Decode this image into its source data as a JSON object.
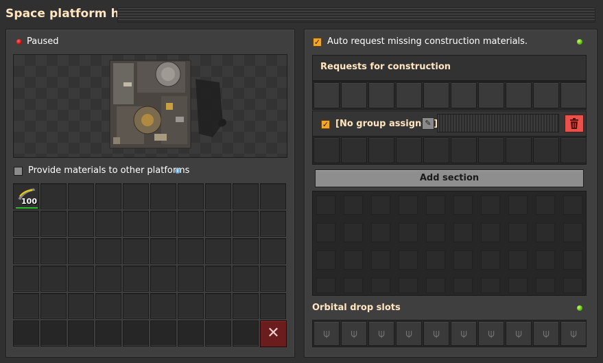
{
  "window": {
    "title": "Space platform hub"
  },
  "left": {
    "status": {
      "text": "Paused",
      "color": "#d00000"
    },
    "provide_checkbox": {
      "label": "Provide materials to other platforms",
      "checked": false
    },
    "inventory": {
      "first_slot": {
        "icon": "thruster-fuel-icon",
        "count": "100"
      },
      "trash_icon": "close-x-icon"
    }
  },
  "right": {
    "auto_request": {
      "label": "Auto request missing construction materials.",
      "checked": true,
      "indicator_color": "#4fb000"
    },
    "requests": {
      "title": "Requests for construction"
    },
    "group": {
      "label": "[No group assigned]",
      "checked": true,
      "edit_icon": "pencil-icon",
      "delete_icon": "trash-icon"
    },
    "add_section_label": "Add section",
    "orbital": {
      "title": "Orbital drop slots",
      "indicator_color": "#4fb000",
      "slot_icon": "cargo-pod-icon"
    }
  },
  "colors": {
    "title": "#ffe6c0",
    "panel": "#403f40",
    "accent_orange": "#f3a623",
    "danger": "#e8524a"
  }
}
